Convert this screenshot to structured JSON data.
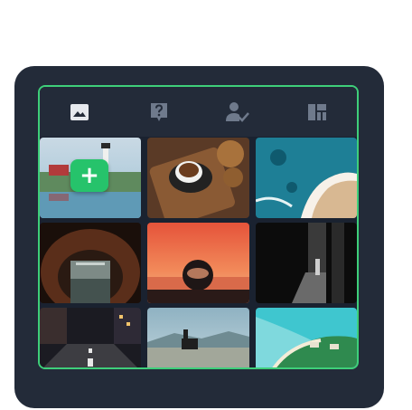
{
  "panel": {
    "tabs": [
      {
        "name": "image-icon"
      },
      {
        "name": "question-icon"
      },
      {
        "name": "user-check-icon"
      },
      {
        "name": "layout-icon"
      }
    ],
    "add_label": "+",
    "colors": {
      "card": "#232b39",
      "accent": "#3ecf7a",
      "add": "#26c36b",
      "icon": "#6f7a8c",
      "icon_active": "#e6e9ee"
    }
  },
  "gallery": [
    {
      "name": "lighthouse-photo"
    },
    {
      "name": "coffee-cookies-photo"
    },
    {
      "name": "coast-aerial-photo"
    },
    {
      "name": "cave-tunnel-photo"
    },
    {
      "name": "crystal-ball-sunset-photo"
    },
    {
      "name": "dark-architecture-photo"
    },
    {
      "name": "city-street-photo"
    },
    {
      "name": "church-landscape-photo"
    },
    {
      "name": "tropical-island-photo"
    }
  ]
}
